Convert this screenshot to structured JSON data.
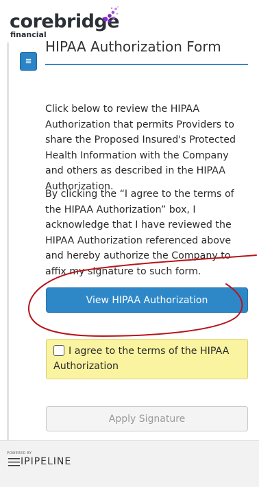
{
  "logo": {
    "brand": "corebridge",
    "sub": "financial"
  },
  "menu": {
    "icon": "hamburger-icon",
    "glyph": "≡"
  },
  "form": {
    "title": "HIPAA Authorization Form",
    "paragraph1": "Click below to review the HIPAA Authorization that permits Providers to share the Proposed Insured's Protected Health Information with the Company and others as described in the HIPAA Authorization.",
    "paragraph2": "By clicking the “I agree to the terms of the HIPAA Authorization” box, I acknowledge that I have reviewed the HIPAA Authorization referenced above and hereby authorize the Company to affix my signature to such form."
  },
  "buttons": {
    "view_label": "View HIPAA Authorization",
    "apply_label": "Apply Signature"
  },
  "agree": {
    "label": "I agree to the terms of the HIPAA Authorization",
    "checked": false
  },
  "footer": {
    "powered_by": "POWERED BY",
    "brand": "IPIPELINE"
  },
  "colors": {
    "accent": "#2e88c8",
    "agree_bg": "#faf3a0",
    "annotation": "#b8141a"
  }
}
